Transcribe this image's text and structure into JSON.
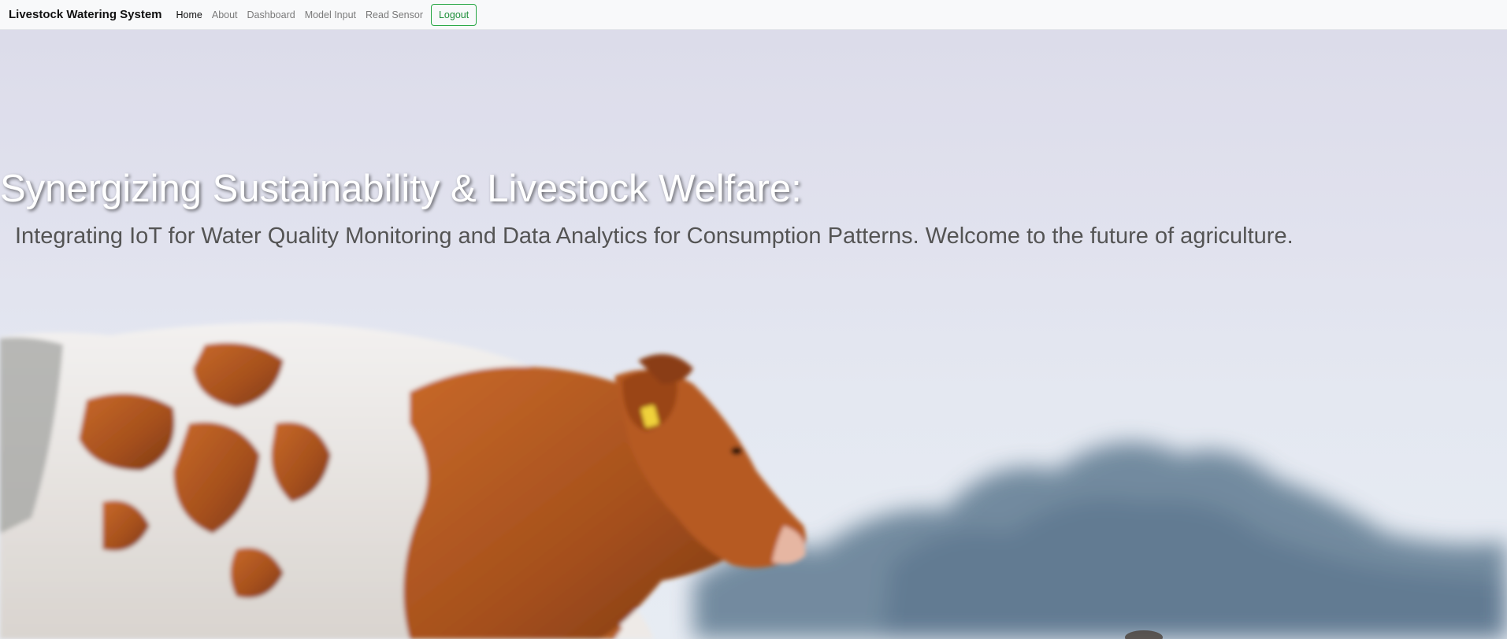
{
  "navbar": {
    "brand": "Livestock Watering System",
    "links": [
      {
        "label": "Home",
        "active": true
      },
      {
        "label": "About",
        "active": false
      },
      {
        "label": "Dashboard",
        "active": false
      },
      {
        "label": "Model Input",
        "active": false
      },
      {
        "label": "Read Sensor",
        "active": false
      }
    ],
    "logout_label": "Logout"
  },
  "hero": {
    "title": "Synergizing Sustainability & Livestock Welfare:",
    "subtitle": "Integrating IoT for Water Quality Monitoring and Data Analytics for Consumption Patterns. Welcome to the future of agriculture.",
    "image": "cow-in-pasture-photo"
  },
  "colors": {
    "navbar_bg": "#f8f9fa",
    "logout_accent": "#28a745",
    "title_text": "#ffffff",
    "subtitle_text": "#545454"
  }
}
